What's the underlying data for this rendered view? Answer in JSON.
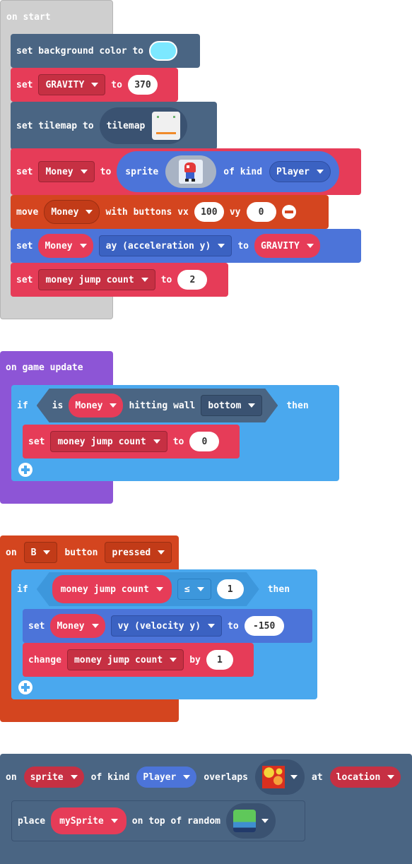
{
  "on_start": {
    "hat": "on start",
    "bg_row": {
      "text": "set background color to",
      "color": "#7ce8ff"
    },
    "gravity_row": {
      "set": "set",
      "var": "GRAVITY",
      "to": "to",
      "value": "370"
    },
    "tilemap_row": {
      "text": "set tilemap to",
      "chip": "tilemap"
    },
    "money_row": {
      "set": "set",
      "var": "Money",
      "to": "to",
      "sprite": "sprite",
      "of_kind": "of kind",
      "kind": "Player"
    },
    "move_row": {
      "move": "move",
      "var": "Money",
      "with": "with buttons vx",
      "vx": "100",
      "vy_label": "vy",
      "vy": "0"
    },
    "ay_row": {
      "set": "set",
      "var": "Money",
      "prop": "ay (acceleration y)",
      "to": "to",
      "value": "GRAVITY"
    },
    "jump_row": {
      "set": "set",
      "var": "money jump count",
      "to": "to",
      "value": "2"
    }
  },
  "on_update": {
    "hat": "on game update",
    "if": "if",
    "is": "is",
    "var": "Money",
    "hitting": "hitting wall",
    "side": "bottom",
    "then": "then",
    "set_row": {
      "set": "set",
      "var": "money jump count",
      "to": "to",
      "value": "0"
    }
  },
  "on_button": {
    "on": "on",
    "button": "B",
    "button_label": "button",
    "event": "pressed",
    "if": "if",
    "var": "money jump count",
    "op": "≤",
    "cmp": "1",
    "then": "then",
    "set_row": {
      "set": "set",
      "var": "Money",
      "prop": "vy (velocity y)",
      "to": "to",
      "value": "-150"
    },
    "change_row": {
      "change": "change",
      "var": "money jump count",
      "by": "by",
      "value": "1"
    }
  },
  "on_overlap": {
    "on": "on",
    "sprite": "sprite",
    "of_kind": "of kind",
    "kind": "Player",
    "overlaps": "overlaps",
    "at": "at",
    "location": "location",
    "place_row": {
      "place": "place",
      "var": "mySprite",
      "on_top": "on top of random"
    }
  }
}
